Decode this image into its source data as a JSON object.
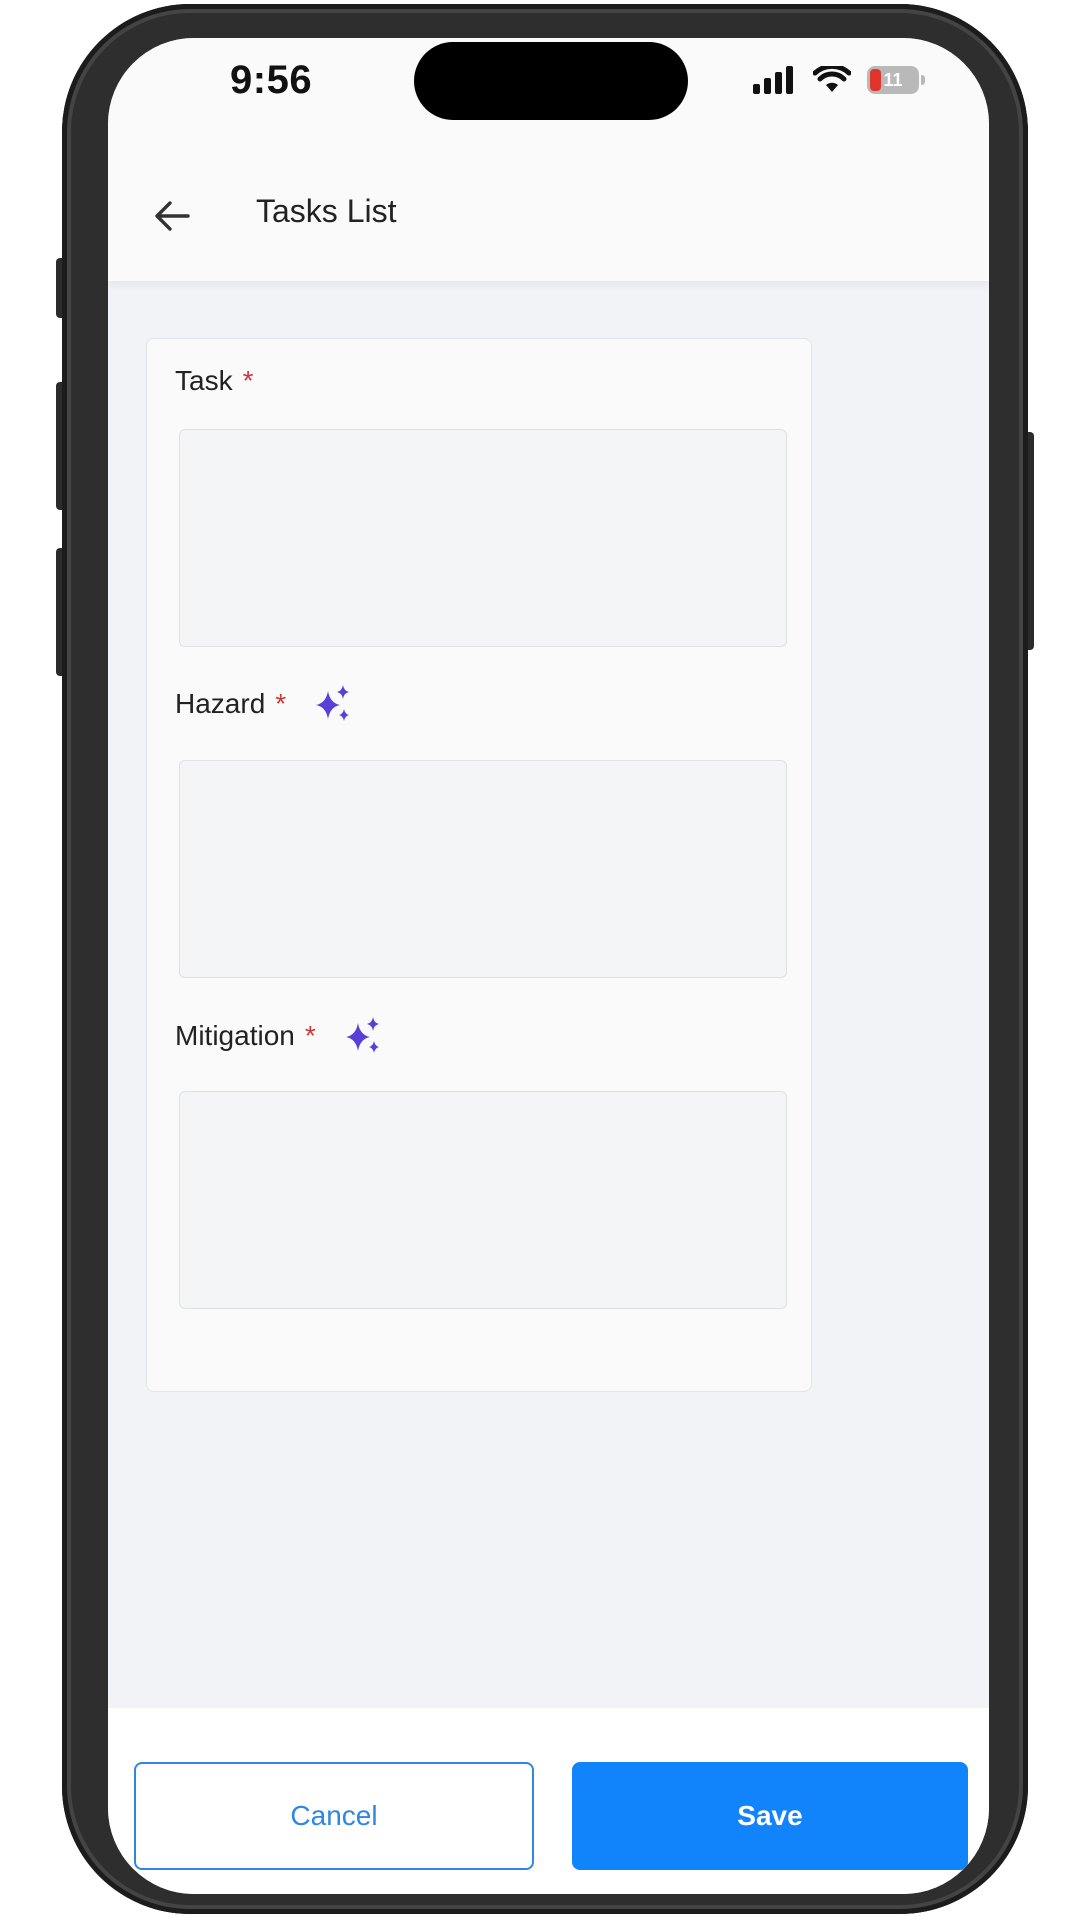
{
  "status_bar": {
    "time": "9:56",
    "battery_level": "11",
    "signal_icon": "cellular-signal-icon",
    "wifi_icon": "wifi-icon",
    "battery_icon": "battery-low-charging-icon"
  },
  "header": {
    "back_icon": "arrow-left-icon",
    "title": "Tasks List"
  },
  "form": {
    "required_marker": "*",
    "ai_icon": "sparkle-icon",
    "ai_color": "#5a3fd6",
    "fields": [
      {
        "label": "Task",
        "value": "",
        "has_ai": false
      },
      {
        "label": "Hazard",
        "value": "",
        "has_ai": true
      },
      {
        "label": "Mitigation",
        "value": "",
        "has_ai": true
      }
    ]
  },
  "actions": {
    "cancel_label": "Cancel",
    "save_label": "Save",
    "accent_color": "#1183fb"
  }
}
